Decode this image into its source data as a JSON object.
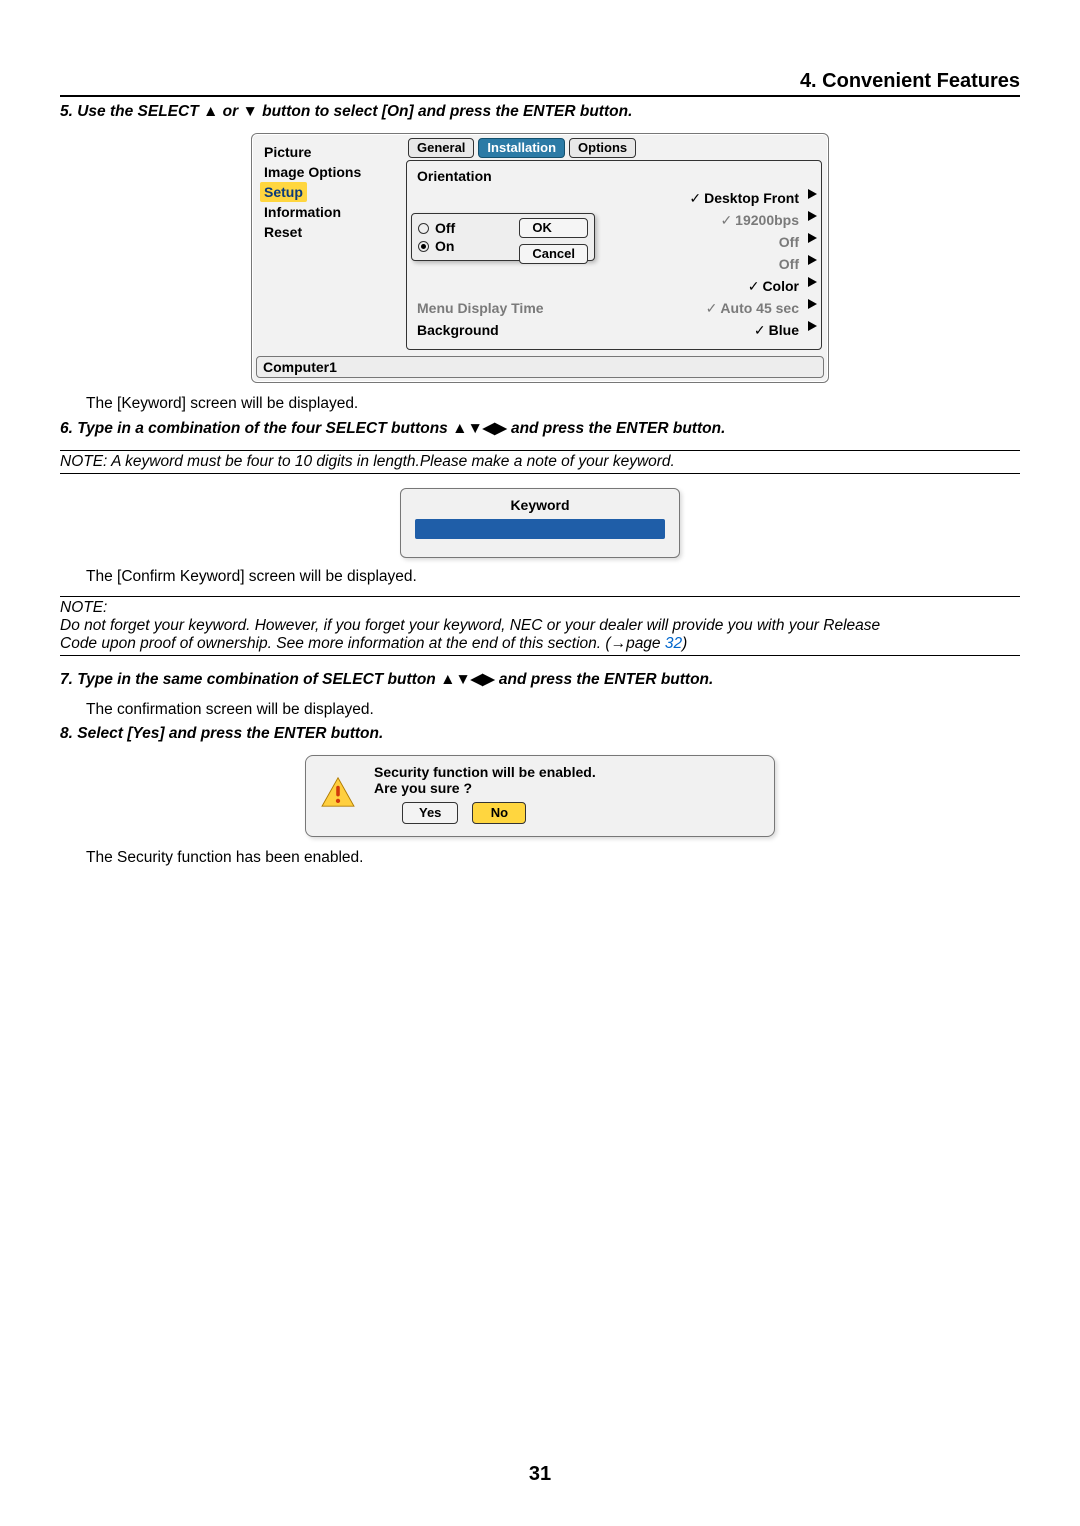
{
  "header": {
    "title": "4. Convenient Features"
  },
  "step5": {
    "prefix": "5.  Use the SELECT ",
    "arrows1": "▲",
    "mid": " or ",
    "arrows2": "▼",
    "suffix": " button to select [On] and press the ENTER button."
  },
  "menu": {
    "nav": [
      "Picture",
      "Image Options",
      "Setup",
      "Information",
      "Reset"
    ],
    "tabs": [
      "General",
      "Installation",
      "Options"
    ],
    "rows": [
      {
        "label": "Orientation",
        "value": ""
      },
      {
        "label": "",
        "value": "Desktop Front"
      },
      {
        "label": "",
        "value": "19200bps"
      },
      {
        "label": "",
        "value": "Off"
      },
      {
        "label": "",
        "value": "Off"
      },
      {
        "label": "",
        "value": "Color"
      },
      {
        "label": "Menu Display Time",
        "value": "Auto 45 sec"
      },
      {
        "label": "Background",
        "value": "Blue"
      }
    ],
    "dialog": {
      "off": "Off",
      "on": "On",
      "ok": "OK",
      "cancel": "Cancel"
    },
    "status": "Computer1"
  },
  "after5": "The [Keyword] screen will be displayed.",
  "step6": {
    "prefix": "6.  Type in a combination of the four SELECT buttons  ",
    "arrows": "▲▼◀▶",
    "suffix": " and press the ENTER button."
  },
  "note1": "NOTE: A keyword must be four to 10  digits in length.Please make a note of your keyword.",
  "keyword_label": "Keyword",
  "after_keyword": "The [Confirm Keyword] screen will be displayed.",
  "note2a": "NOTE:",
  "note2b_1": "Do not forget your keyword. However, if you forget your keyword, NEC or your dealer will provide you with your Release",
  "note2b_2": "Code upon proof of ownership. See more information at the end of this section. (→page ",
  "note2_link": "32",
  "note2b_3": ")",
  "step7": {
    "prefix": "7.  Type in the same combination of SELECT button ",
    "arrows": "▲▼◀▶",
    "suffix": "  and press the ENTER button."
  },
  "after7": "The confirmation screen will be displayed.",
  "step8": "8.  Select [Yes] and press the ENTER button.",
  "confirm": {
    "line1": "Security function will be enabled.",
    "line2": "Are you sure ?",
    "yes": "Yes",
    "no": "No"
  },
  "after8": "The Security function has been enabled.",
  "page": "31"
}
